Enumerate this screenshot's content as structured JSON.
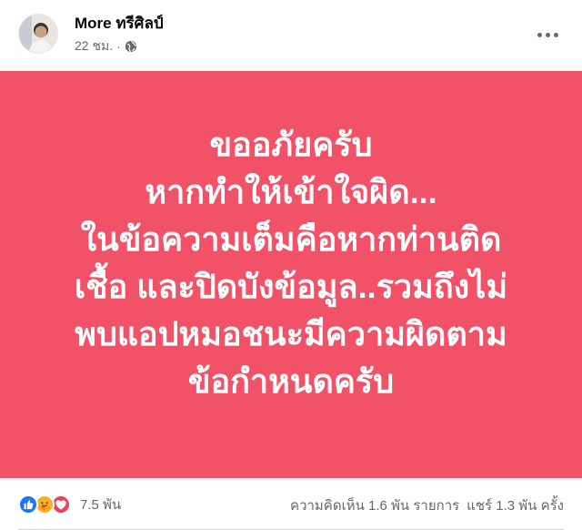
{
  "post": {
    "author": "More ทรีศิลป์",
    "time": "22 ชม.",
    "time_separator": "·",
    "privacy_icon": "globe-icon",
    "menu_icon": "more-options-icon",
    "banner_color": "#f25268",
    "banner_lines": [
      "ขออภัยครับ",
      "หากทำให้เข้าใจผิด...",
      "ในข้อความเต็มคือหากท่านติด",
      "เชื้อ และปิดบังข้อมูล..รวมถึงไม่",
      "พบแอปหมอชนะมีความผิดตาม",
      "ข้อกำหนดครับ"
    ]
  },
  "footer": {
    "reaction_icons": [
      "like-icon",
      "care-icon",
      "love-icon"
    ],
    "reaction_count": "7.5 พัน",
    "comments": "ความคิดเห็น 1.6 พัน รายการ",
    "shares": "แชร์ 1.3 พัน ครั้ง"
  }
}
